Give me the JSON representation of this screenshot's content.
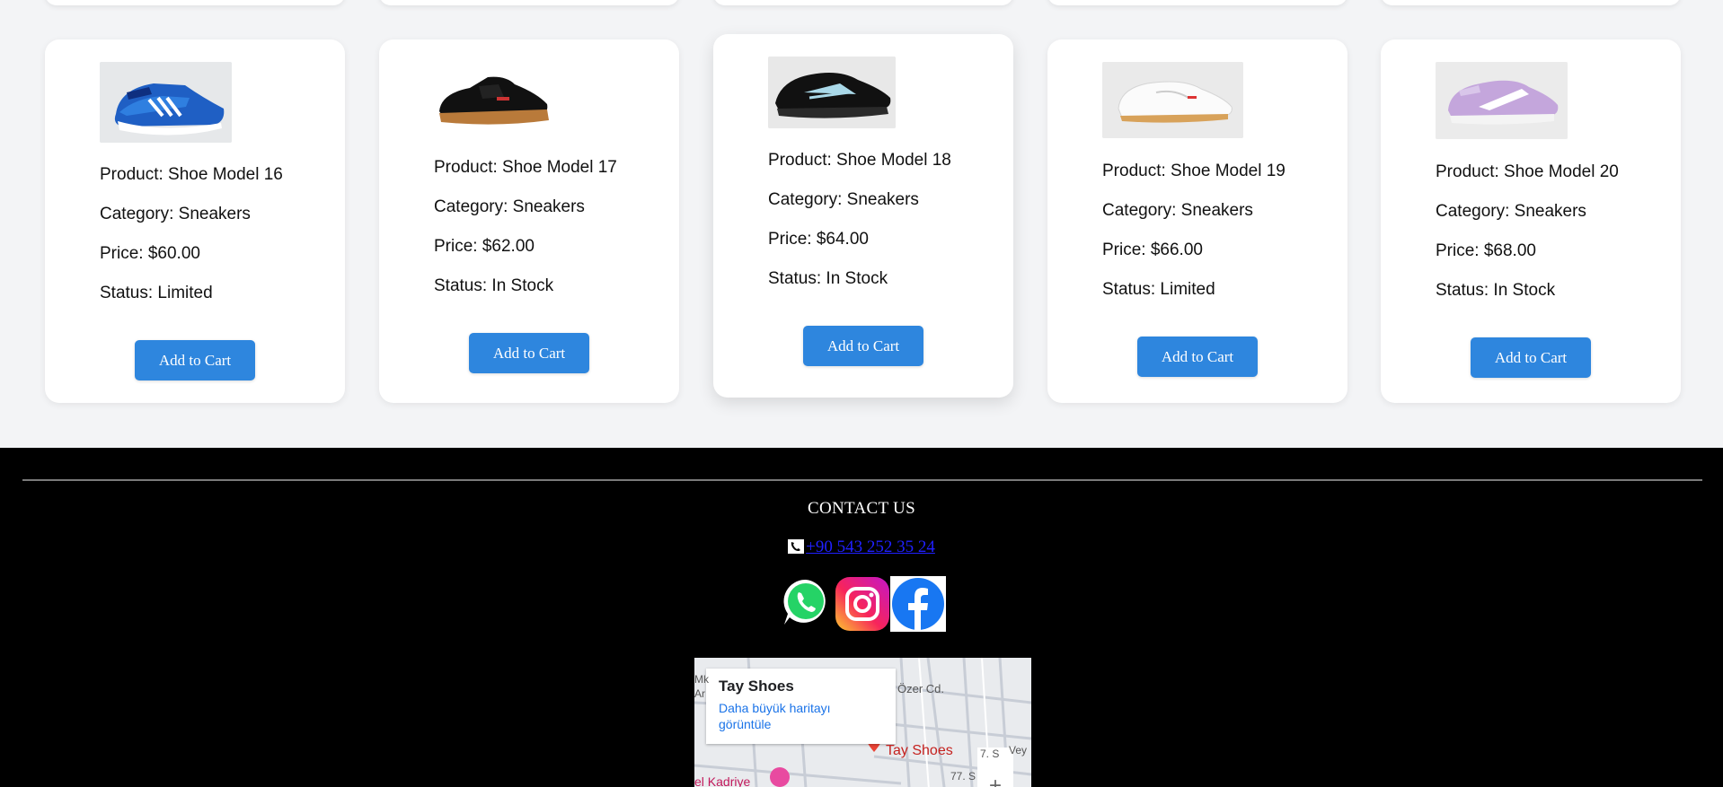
{
  "products": [
    {
      "name_line": "Product: Shoe Model 16",
      "category_line": "Category: Sneakers",
      "price_line": "Price: $60.00",
      "status_line": "Status: Limited",
      "button": "Add to Cart",
      "image_icon": "blue-sneaker-icon"
    },
    {
      "name_line": "Product: Shoe Model 17",
      "category_line": "Category: Sneakers",
      "price_line": "Price: $62.00",
      "status_line": "Status: In Stock",
      "button": "Add to Cart",
      "image_icon": "black-gum-sneaker-icon"
    },
    {
      "name_line": "Product: Shoe Model 18",
      "category_line": "Category: Sneakers",
      "price_line": "Price: $64.00",
      "status_line": "Status: In Stock",
      "button": "Add to Cart",
      "image_icon": "black-running-shoe-icon"
    },
    {
      "name_line": "Product: Shoe Model 19",
      "category_line": "Category: Sneakers",
      "price_line": "Price: $66.00",
      "status_line": "Status: Limited",
      "button": "Add to Cart",
      "image_icon": "white-classic-sneaker-icon"
    },
    {
      "name_line": "Product: Shoe Model 20",
      "category_line": "Category: Sneakers",
      "price_line": "Price: $68.00",
      "status_line": "Status: In Stock",
      "button": "Add to Cart",
      "image_icon": "lilac-sneaker-icon"
    }
  ],
  "footer": {
    "title": "CONTACT US",
    "phone": "+90 543 252 35 24",
    "social": [
      "whatsapp-icon",
      "instagram-icon",
      "facebook-icon"
    ]
  },
  "map": {
    "place_name": "Tay Shoes",
    "link_text": "Daha büyük haritayı görüntüle",
    "marker_label": "Tay Shoes",
    "street_1": "Özer Cd.",
    "street_2": "el Kadriye",
    "street_3": "7. S",
    "street_4": "Vey",
    "street_5": "77. S",
    "edge_text": "Mk Ar"
  },
  "colors": {
    "button": "#2e86de",
    "footer_bg": "#000000",
    "page_bg": "#f3f4f6",
    "link": "#2020ff",
    "map_pin": "#ea4335"
  }
}
